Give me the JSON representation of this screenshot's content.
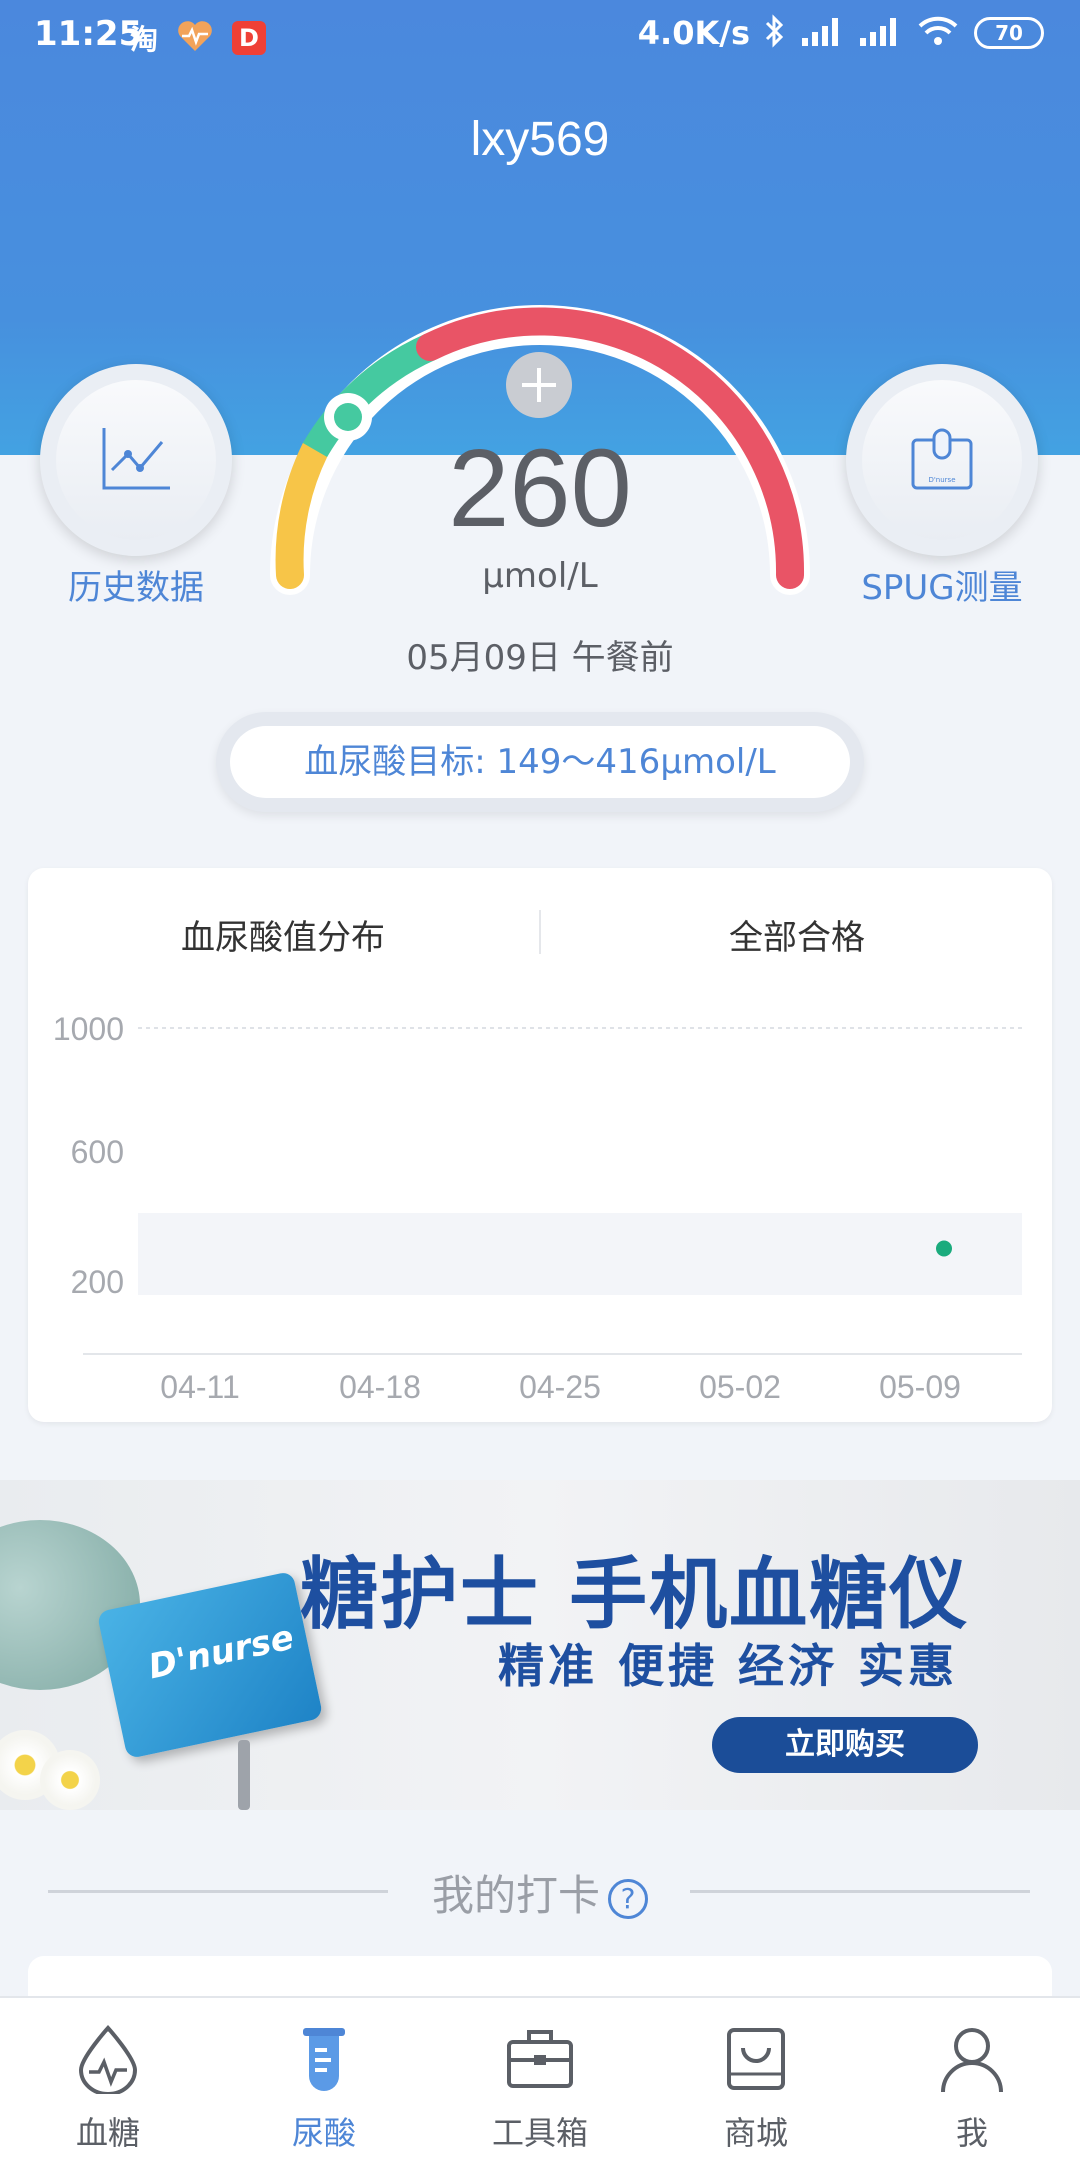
{
  "status_bar": {
    "time": "11:25",
    "left_icons": [
      "taobao-icon",
      "heart-rate-icon",
      "dnurse-app-icon"
    ],
    "taobao_glyph": "淘",
    "network_speed": "4.0K/s",
    "battery": "70"
  },
  "header": {
    "username": "lxy569"
  },
  "history_button": {
    "label": "历史数据"
  },
  "spug_button": {
    "label": "SPUG测量"
  },
  "gauge": {
    "value": "260",
    "unit": "μmol/L",
    "datetime": "05月09日 午餐前",
    "colors": {
      "low": "#f7c548",
      "normal": "#45c9a0",
      "high": "#e95466"
    }
  },
  "target": {
    "text": "血尿酸目标: 149～416μmol/L"
  },
  "chart_tabs": {
    "left": "血尿酸值分布",
    "right": "全部合格"
  },
  "chart_data": {
    "type": "scatter",
    "ylim": [
      0,
      1000
    ],
    "y_ticks": [
      "1000",
      "600",
      "200"
    ],
    "x_ticks": [
      "04-11",
      "04-18",
      "04-25",
      "05-02",
      "05-09"
    ],
    "target_band": [
      149,
      416
    ],
    "points": [
      {
        "x": "05-09",
        "y": 260
      }
    ],
    "point_color": "#1aab7d"
  },
  "banner": {
    "title": "糖护士  手机血糖仪",
    "subtitle": "精准 便捷 经济 实惠",
    "button": "立即购买",
    "device_brand": "D'nurse"
  },
  "checkin": {
    "title": "我的打卡",
    "help": "?"
  },
  "bottom_nav": [
    {
      "label": "血糖",
      "icon": "blood-drop-icon",
      "active": false
    },
    {
      "label": "尿酸",
      "icon": "test-tube-icon",
      "active": true
    },
    {
      "label": "工具箱",
      "icon": "toolbox-icon",
      "active": false
    },
    {
      "label": "商城",
      "icon": "shopping-bag-icon",
      "active": false
    },
    {
      "label": "我",
      "icon": "user-icon",
      "active": false
    }
  ]
}
